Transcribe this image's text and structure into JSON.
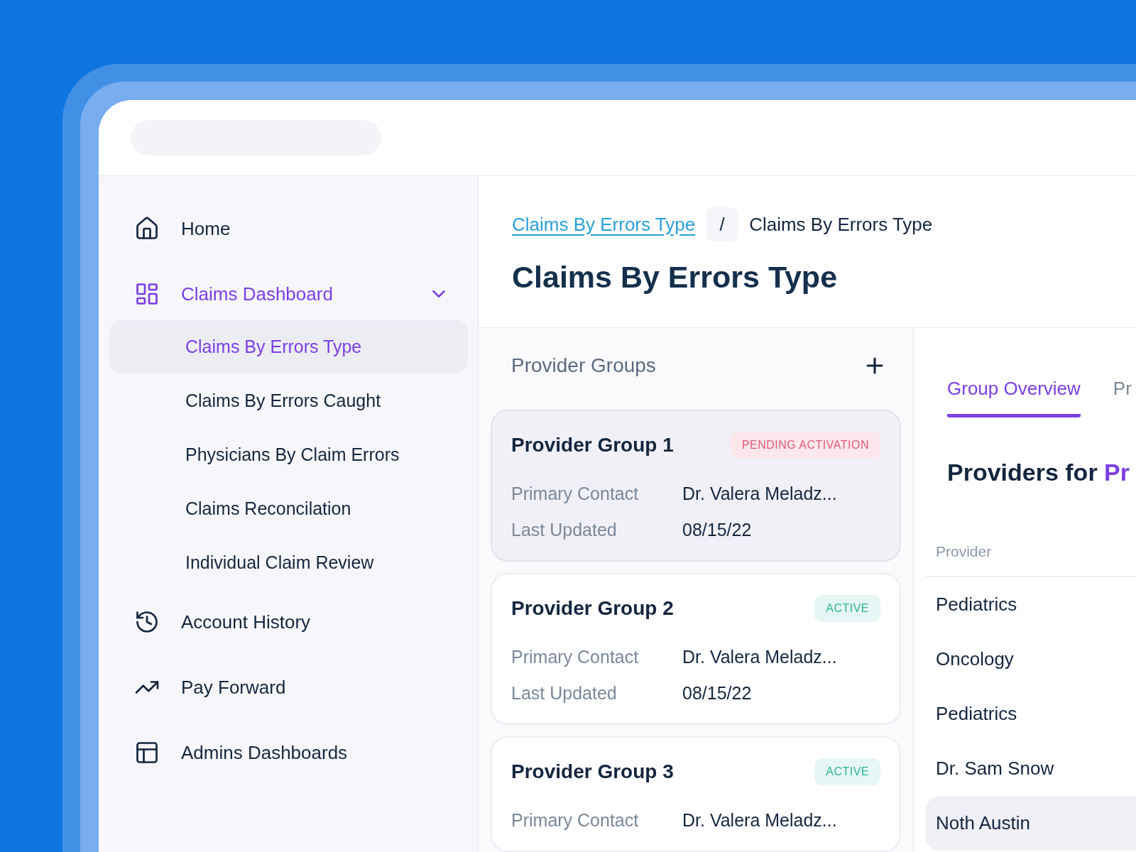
{
  "sidebar": {
    "items": [
      {
        "label": "Home",
        "selected": false
      },
      {
        "label": "Claims Dashboard",
        "selected": true,
        "expanded": true,
        "children": [
          {
            "label": "Claims By Errors Type",
            "selected": true
          },
          {
            "label": "Claims By Errors Caught",
            "selected": false
          },
          {
            "label": "Physicians By Claim Errors",
            "selected": false
          },
          {
            "label": "Claims Reconcilation",
            "selected": false
          },
          {
            "label": "Individual Claim Review",
            "selected": false
          }
        ]
      },
      {
        "label": "Account History",
        "selected": false
      },
      {
        "label": "Pay Forward",
        "selected": false
      },
      {
        "label": "Admins Dashboards",
        "selected": false
      }
    ]
  },
  "breadcrumbs": {
    "link": "Claims By Errors Type",
    "separator": "/",
    "current": "Claims By Errors Type"
  },
  "page_title": "Claims By Errors Type",
  "provider_groups": {
    "title": "Provider Groups",
    "cards": [
      {
        "title": "Provider Group 1",
        "selected": true,
        "status": {
          "label": "PENDING ACTIVATION",
          "kind": "pending"
        },
        "fields": [
          {
            "label": "Primary Contact",
            "value": "Dr. Valera Meladz..."
          },
          {
            "label": "Last Updated",
            "value": "08/15/22"
          }
        ]
      },
      {
        "title": "Provider Group 2",
        "selected": false,
        "status": {
          "label": "ACTIVE",
          "kind": "active"
        },
        "fields": [
          {
            "label": "Primary Contact",
            "value": "Dr. Valera Meladz..."
          },
          {
            "label": "Last Updated",
            "value": "08/15/22"
          }
        ]
      },
      {
        "title": "Provider Group 3",
        "selected": false,
        "status": {
          "label": "ACTIVE",
          "kind": "active"
        },
        "fields": [
          {
            "label": "Primary Contact",
            "value": "Dr. Valera Meladz..."
          }
        ]
      }
    ]
  },
  "detail": {
    "tabs": [
      {
        "label": "Group Overview",
        "selected": true
      },
      {
        "label": "Pr",
        "selected": false
      }
    ],
    "heading": {
      "text": "Providers for ",
      "highlight": "Pr"
    },
    "table": {
      "columns": [
        "Provider"
      ],
      "rows": [
        {
          "cells": [
            "Pediatrics"
          ],
          "selected": false
        },
        {
          "cells": [
            "Oncology"
          ],
          "selected": false
        },
        {
          "cells": [
            "Pediatrics"
          ],
          "selected": false
        },
        {
          "cells": [
            "Dr. Sam Snow"
          ],
          "selected": false
        },
        {
          "cells": [
            "Noth Austin"
          ],
          "selected": true
        }
      ]
    }
  }
}
